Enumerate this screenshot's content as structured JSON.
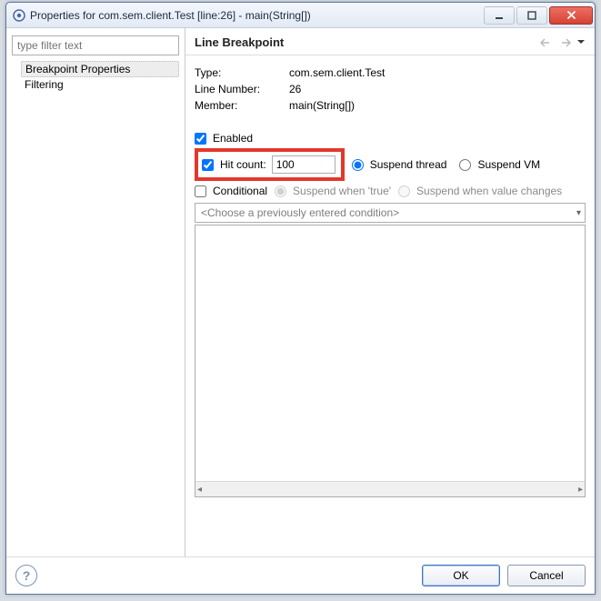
{
  "window": {
    "title": "Properties for com.sem.client.Test [line:26] - main(String[])"
  },
  "sidebar": {
    "filter_placeholder": "type filter text",
    "items": [
      {
        "label": "Breakpoint Properties",
        "selected": true
      },
      {
        "label": "Filtering",
        "selected": false
      }
    ]
  },
  "header": {
    "title": "Line Breakpoint"
  },
  "details": {
    "type_label": "Type:",
    "type_value": "com.sem.client.Test",
    "line_label": "Line Number:",
    "line_value": "26",
    "member_label": "Member:",
    "member_value": "main(String[])"
  },
  "controls": {
    "enabled_label": "Enabled",
    "enabled_checked": true,
    "hit_count_label": "Hit count:",
    "hit_count_checked": true,
    "hit_count_value": "100",
    "suspend_thread_label": "Suspend thread",
    "suspend_thread_selected": true,
    "suspend_vm_label": "Suspend VM",
    "suspend_vm_selected": false,
    "conditional_label": "Conditional",
    "conditional_checked": false,
    "suspend_true_label": "Suspend when 'true'",
    "suspend_true_selected": true,
    "suspend_change_label": "Suspend when value changes",
    "suspend_change_selected": false,
    "condition_combo_placeholder": "<Choose a previously entered condition>"
  },
  "footer": {
    "ok_label": "OK",
    "cancel_label": "Cancel"
  }
}
